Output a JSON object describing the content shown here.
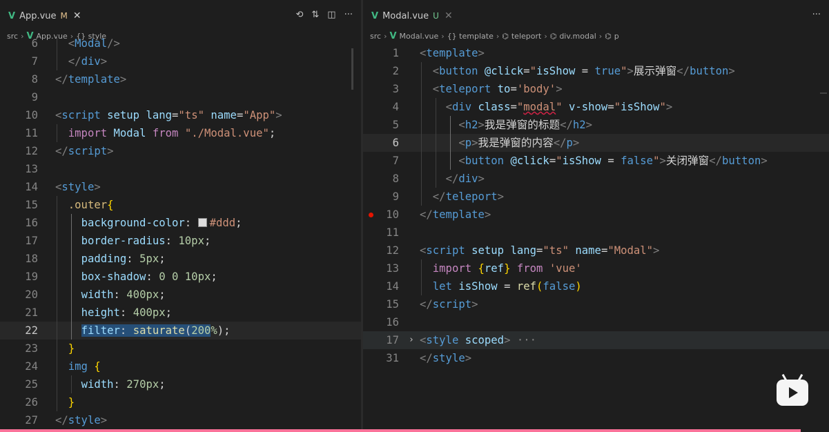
{
  "left": {
    "tab": {
      "label": "App.vue",
      "status": "M",
      "close": "✕"
    },
    "actions": [
      "⟲",
      "⇅",
      "◫",
      "···"
    ],
    "breadcrumb": [
      "src",
      "App.vue",
      "{} style"
    ],
    "lines": [
      {
        "n": "6",
        "html": "<span class='br'>  &lt;</span><span class='tag'>Modal</span><span class='br'>/&gt;</span>"
      },
      {
        "n": "7",
        "html": "  <span class='br'>&lt;/</span><span class='tag'>div</span><span class='br'>&gt;</span>"
      },
      {
        "n": "8",
        "html": "<span class='br'>&lt;/</span><span class='tag'>template</span><span class='br'>&gt;</span>"
      },
      {
        "n": "9",
        "html": ""
      },
      {
        "n": "10",
        "html": "<span class='br'>&lt;</span><span class='tag'>script</span> <span class='at'>setup</span> <span class='at'>lang</span>=<span class='str'>\"ts\"</span> <span class='at'>name</span>=<span class='str'>\"App\"</span><span class='br'>&gt;</span>"
      },
      {
        "n": "11",
        "html": "  <span class='imp'>import</span> <span class='prop'>Modal</span> <span class='imp'>from</span> <span class='str'>\"./Modal.vue\"</span>;"
      },
      {
        "n": "12",
        "html": "<span class='br'>&lt;/</span><span class='tag'>script</span><span class='br'>&gt;</span>"
      },
      {
        "n": "13",
        "html": ""
      },
      {
        "n": "14",
        "html": "<span class='br'>&lt;</span><span class='tag'>style</span><span class='br'>&gt;</span>"
      },
      {
        "n": "15",
        "html": "  <span class='sel'>.outer</span><span class='brk'>{</span>"
      },
      {
        "n": "16",
        "html": "    <span class='prop'>background-color</span>: <span class='swatch'></span><span class='val'>#ddd</span>;"
      },
      {
        "n": "17",
        "html": "    <span class='prop'>border-radius</span>: <span class='num'>10px</span>;"
      },
      {
        "n": "18",
        "html": "    <span class='prop'>padding</span>: <span class='num'>5px</span>;"
      },
      {
        "n": "19",
        "html": "    <span class='prop'>box-shadow</span>: <span class='num'>0</span> <span class='num'>0</span> <span class='num'>10px</span>;"
      },
      {
        "n": "20",
        "html": "    <span class='prop'>width</span>: <span class='num'>400px</span>;"
      },
      {
        "n": "21",
        "html": "    <span class='prop'>height</span>: <span class='num'>400px</span>;"
      },
      {
        "n": "22",
        "html": "    <span class='selbg'><span class='prop'>filter</span>: <span class='fn'>saturate</span>(<span class='num'>200</span></span><span class='num'>%</span>);",
        "active": true
      },
      {
        "n": "23",
        "html": "  <span class='brk'>}</span>"
      },
      {
        "n": "24",
        "html": "  <span class='tag'>img</span> <span class='brk'>{</span>"
      },
      {
        "n": "25",
        "html": "    <span class='prop'>width</span>: <span class='num'>270px</span>;"
      },
      {
        "n": "26",
        "html": "  <span class='brk'>}</span>"
      },
      {
        "n": "27",
        "html": "<span class='br'>&lt;/</span><span class='tag'>style</span><span class='br'>&gt;</span>"
      }
    ]
  },
  "right": {
    "tab": {
      "label": "Modal.vue",
      "status": "U",
      "close": "✕"
    },
    "actions": [
      "···"
    ],
    "breadcrumb": [
      "src",
      "Modal.vue",
      "{} template",
      "teleport",
      "div.modal",
      "p"
    ],
    "lines": [
      {
        "n": "1",
        "html": "<span class='br'>&lt;</span><span class='tag'>template</span><span class='br'>&gt;</span>"
      },
      {
        "n": "2",
        "html": "  <span class='br'>&lt;</span><span class='tag'>button</span> <span class='at'>@click</span>=<span class='str'>\"</span><span class='prop'>isShow</span> = <span class='kw'>true</span><span class='str'>\"</span><span class='br'>&gt;</span>展示弹窗<span class='br'>&lt;/</span><span class='tag'>button</span><span class='br'>&gt;</span>"
      },
      {
        "n": "3",
        "html": "  <span class='br'>&lt;</span><span class='tag'>teleport</span> <span class='at'>to</span>=<span class='str'>'body'</span><span class='br'>&gt;</span>"
      },
      {
        "n": "4",
        "html": "    <span class='br'>&lt;</span><span class='tag'>div</span> <span class='at'>class</span>=<span class='str'>\"</span><span class='str underline-red'>modal</span><span class='str'>\"</span> <span class='at'>v-show</span>=<span class='str'>\"</span><span class='prop'>isShow</span><span class='str'>\"</span><span class='br'>&gt;</span>"
      },
      {
        "n": "5",
        "html": "      <span class='br'>&lt;</span><span class='tag'>h2</span><span class='br'>&gt;</span>我是弹窗的标题<span class='br'>&lt;/</span><span class='tag'>h2</span><span class='br'>&gt;</span>"
      },
      {
        "n": "6",
        "html": "      <span class='br'>&lt;</span><span class='tag'>p</span><span class='br'>&gt;</span>我是弹窗的内容<span class='br'>&lt;/</span><span class='tag'>p</span><span class='br'>&gt;</span>",
        "active": true
      },
      {
        "n": "7",
        "html": "      <span class='br'>&lt;</span><span class='tag'>button</span> <span class='at'>@click</span>=<span class='str'>\"</span><span class='prop'>isShow</span> = <span class='kw'>false</span><span class='str'>\"</span><span class='br'>&gt;</span>关闭弹窗<span class='br'>&lt;/</span><span class='tag'>button</span><span class='br'>&gt;</span>"
      },
      {
        "n": "8",
        "html": "    <span class='br'>&lt;/</span><span class='tag'>div</span><span class='br'>&gt;</span>"
      },
      {
        "n": "9",
        "html": "  <span class='br'>&lt;/</span><span class='tag'>teleport</span><span class='br'>&gt;</span>"
      },
      {
        "n": "10",
        "html": "<span class='br'>&lt;/</span><span class='tag'>template</span><span class='br'>&gt;</span>",
        "breakpoint": true
      },
      {
        "n": "11",
        "html": ""
      },
      {
        "n": "12",
        "html": "<span class='br'>&lt;</span><span class='tag'>script</span> <span class='at'>setup</span> <span class='at'>lang</span>=<span class='str'>\"ts\"</span> <span class='at'>name</span>=<span class='str'>\"Modal\"</span><span class='br'>&gt;</span>"
      },
      {
        "n": "13",
        "html": "  <span class='imp'>import</span> <span class='brk'>{</span><span class='prop'>ref</span><span class='brk'>}</span> <span class='imp'>from</span> <span class='str'>'vue'</span>"
      },
      {
        "n": "14",
        "html": "  <span class='kw'>let</span> <span class='prop'>isShow</span> = <span class='fn'>ref</span><span class='brk'>(</span><span class='kw'>false</span><span class='brk'>)</span>"
      },
      {
        "n": "15",
        "html": "<span class='br'>&lt;/</span><span class='tag'>script</span><span class='br'>&gt;</span>"
      },
      {
        "n": "16",
        "html": ""
      },
      {
        "n": "17",
        "html": "<span class='br'>&lt;</span><span class='tag'>style</span> <span class='at'>scoped</span><span class='br'>&gt;</span><span class='ellipsis'> ···</span>",
        "folded": true
      },
      {
        "n": "31",
        "html": "<span class='br'>&lt;/</span><span class='tag'>style</span><span class='br'>&gt;</span>"
      }
    ]
  }
}
